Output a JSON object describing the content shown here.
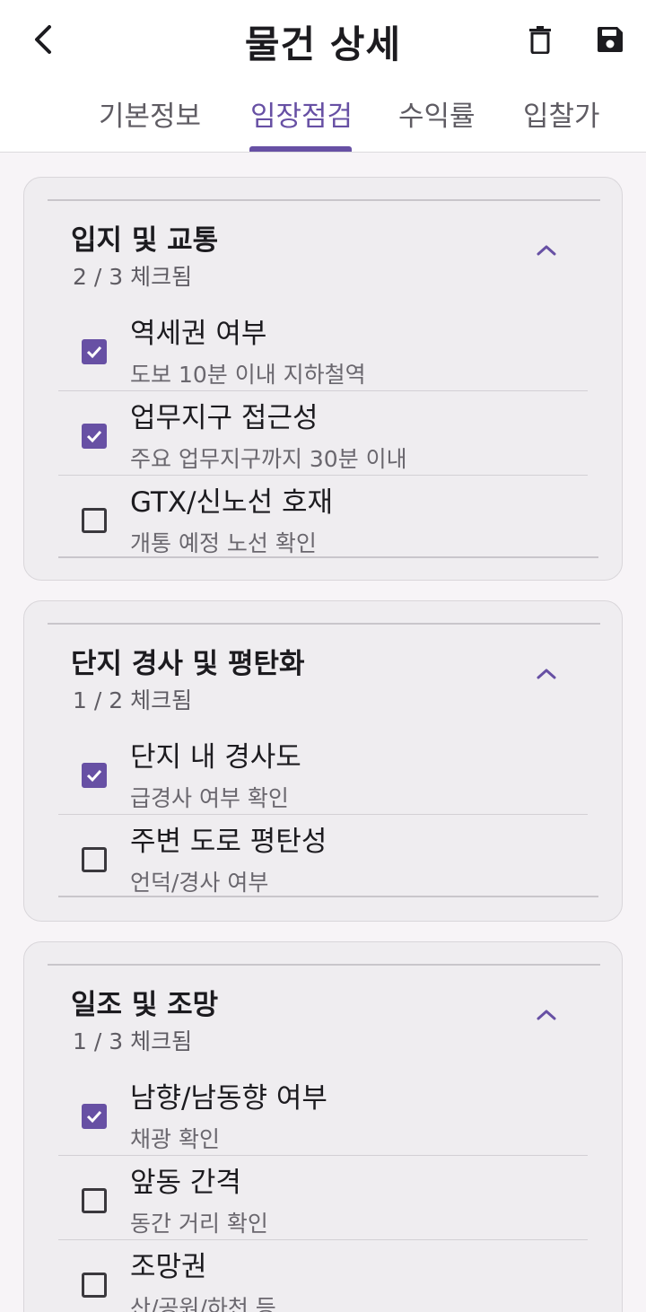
{
  "header": {
    "title": "물건 상세",
    "back_icon": "arrow-back-icon",
    "delete_icon": "trash-icon",
    "save_icon": "save-icon"
  },
  "tabs": [
    {
      "label": "기본정보",
      "active": false
    },
    {
      "label": "임장점검",
      "active": true
    },
    {
      "label": "수익률",
      "active": false
    },
    {
      "label": "입찰가",
      "active": false
    }
  ],
  "colors": {
    "accent": "#6750a4",
    "card_bg": "#efedf0",
    "page_bg": "#f7f4f7"
  },
  "sections": [
    {
      "title": "입지 및 교통",
      "count": "2 / 3 체크됨",
      "items": [
        {
          "title": "역세권 여부",
          "subtitle": "도보 10분 이내 지하철역",
          "checked": true
        },
        {
          "title": "업무지구 접근성",
          "subtitle": "주요 업무지구까지 30분 이내",
          "checked": true
        },
        {
          "title": "GTX/신노선 호재",
          "subtitle": "개통 예정 노선 확인",
          "checked": false
        }
      ]
    },
    {
      "title": "단지 경사 및 평탄화",
      "count": "1 / 2 체크됨",
      "items": [
        {
          "title": "단지 내 경사도",
          "subtitle": "급경사 여부 확인",
          "checked": true
        },
        {
          "title": "주변 도로 평탄성",
          "subtitle": "언덕/경사 여부",
          "checked": false
        }
      ]
    },
    {
      "title": "일조 및 조망",
      "count": "1 / 3 체크됨",
      "items": [
        {
          "title": "남향/남동향 여부",
          "subtitle": "채광 확인",
          "checked": true
        },
        {
          "title": "앞동 간격",
          "subtitle": "동간 거리 확인",
          "checked": false
        },
        {
          "title": "조망권",
          "subtitle": "산/공원/하천 등",
          "checked": false
        }
      ]
    }
  ]
}
